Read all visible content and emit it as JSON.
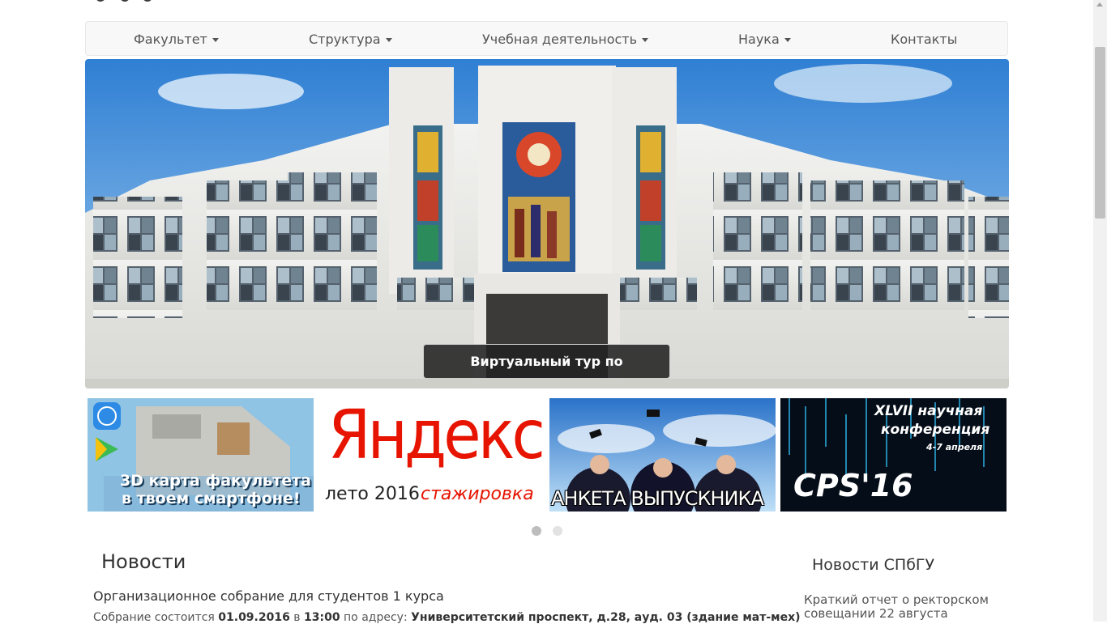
{
  "nav": {
    "items": [
      {
        "label": "Факультет",
        "dropdown": true
      },
      {
        "label": "Структура",
        "dropdown": true
      },
      {
        "label": "Учебная деятельность",
        "dropdown": true
      },
      {
        "label": "Наука",
        "dropdown": true
      },
      {
        "label": "Контакты",
        "dropdown": false
      }
    ]
  },
  "hero": {
    "caption": "Виртуальный тур по факультету"
  },
  "banners": [
    {
      "line1": "3D карта факультета",
      "line2": "в твоем смартфоне!",
      "icons": [
        "app-store-icon",
        "google-play-icon"
      ]
    },
    {
      "brand": "Яндекс",
      "subtitle_a": "лето 2016",
      "subtitle_b": "стажировка"
    },
    {
      "text": "АНКЕТА ВЫПУСКНИКА"
    },
    {
      "line1": "XLVII научная",
      "line2": "конференция",
      "line3": "4-7 апреля",
      "big": "CPS'16"
    }
  ],
  "carousel": {
    "active_index": 0,
    "count": 2
  },
  "news": {
    "title": "Новости",
    "item_title": "Организационное собрание для студентов 1 курса",
    "body_prefix": "Собрание состоится ",
    "date": "01.09.2016",
    "in_word": " в ",
    "time": "13:00",
    "address_prefix": " по адресу: ",
    "address": "Университетский проспект, д.28, ауд. 03 (здание мат-мех)"
  },
  "sidebar": {
    "title": "Новости СПбГУ",
    "link": "Краткий отчет о ректорском совещании 22 августа"
  },
  "colors": {
    "nav_bg": "#f8f8f8",
    "yandex_red": "#e61400",
    "sky_blue": "#3f8fd9"
  }
}
